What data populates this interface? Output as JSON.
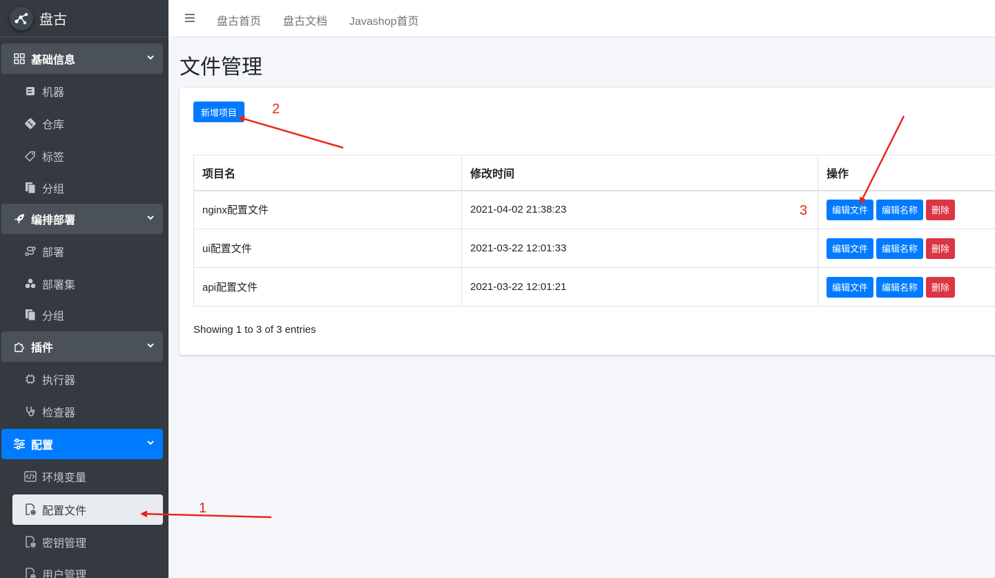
{
  "brand": {
    "name": "盘古"
  },
  "topnav": {
    "links": [
      "盘古首页",
      "盘古文档",
      "Javashop首页"
    ]
  },
  "sidebar": {
    "groups": [
      {
        "label": "基础信息",
        "icon": "grid-icon",
        "items": [
          {
            "label": "机器",
            "icon": "server-icon"
          },
          {
            "label": "仓库",
            "icon": "git-icon"
          },
          {
            "label": "标签",
            "icon": "tag-icon"
          },
          {
            "label": "分组",
            "icon": "copy-icon"
          }
        ]
      },
      {
        "label": "编排部署",
        "icon": "rocket-icon",
        "items": [
          {
            "label": "部署",
            "icon": "route-icon"
          },
          {
            "label": "部署集",
            "icon": "cubes-icon"
          },
          {
            "label": "分组",
            "icon": "copy-icon"
          }
        ]
      },
      {
        "label": "插件",
        "icon": "puzzle-icon",
        "items": [
          {
            "label": "执行器",
            "icon": "chip-icon"
          },
          {
            "label": "检查器",
            "icon": "stethoscope-icon"
          }
        ]
      },
      {
        "label": "配置",
        "icon": "sliders-icon",
        "active": true,
        "items": [
          {
            "label": "环境变量",
            "icon": "code-file-icon"
          },
          {
            "label": "配置文件",
            "icon": "file-gear-icon",
            "active": true
          },
          {
            "label": "密钥管理",
            "icon": "file-gear-icon"
          },
          {
            "label": "用户管理",
            "icon": "file-gear-icon"
          }
        ]
      }
    ]
  },
  "page": {
    "title": "文件管理",
    "add_button": "新增项目"
  },
  "table": {
    "headers": [
      "项目名",
      "修改时间",
      "操作"
    ],
    "rows": [
      {
        "name": "nginx配置文件",
        "time": "2021-04-02 21:38:23"
      },
      {
        "name": "ui配置文件",
        "time": "2021-03-22 12:01:33"
      },
      {
        "name": "api配置文件",
        "time": "2021-03-22 12:01:21"
      }
    ],
    "actions": {
      "edit_file": "编辑文件",
      "edit_name": "编辑名称",
      "delete": "删除"
    },
    "info": "Showing 1 to 3 of 3 entries"
  },
  "annotations": [
    "1",
    "2",
    "3"
  ],
  "colors": {
    "sidebar_bg": "#343a40",
    "primary": "#007bff",
    "danger": "#dc3545",
    "annotation": "#e8261b"
  }
}
